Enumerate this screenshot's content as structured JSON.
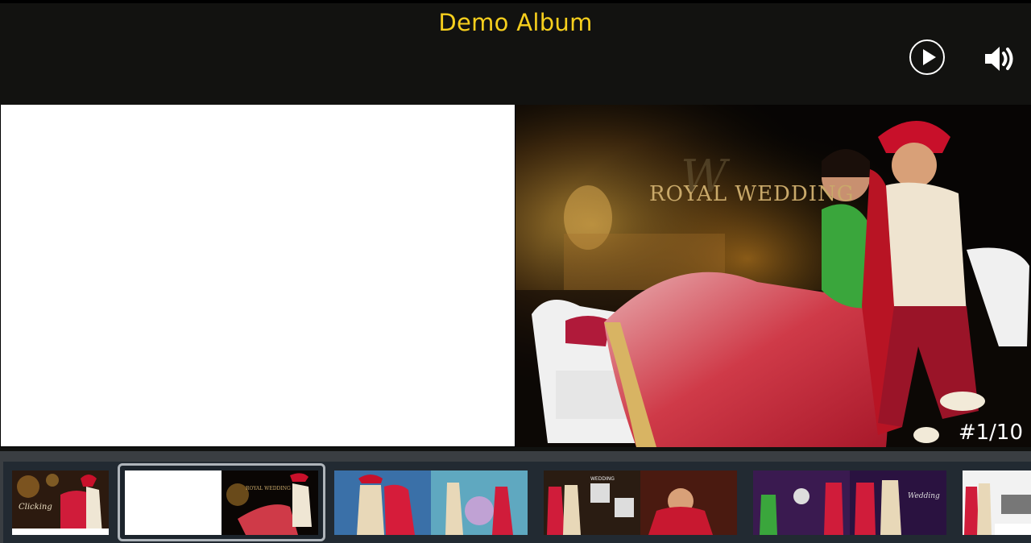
{
  "header": {
    "title": "Demo Album"
  },
  "controls": {
    "play_icon": "play-circle-icon",
    "volume_icon": "volume-icon"
  },
  "viewer": {
    "page_counter": "#1/10",
    "spread_text": "ROYAL WEDDING"
  },
  "thumbnails": [
    {
      "id": 1,
      "text": "Clicking"
    },
    {
      "id": 2,
      "text": "ROYAL WEDDING",
      "selected": true
    },
    {
      "id": 3,
      "text": ""
    },
    {
      "id": 4,
      "text": "WEDDING"
    },
    {
      "id": 5,
      "text": "Wedding"
    },
    {
      "id": 6,
      "text": ""
    }
  ],
  "colors": {
    "title": "#f7cf1d",
    "header_bg": "#121210",
    "strip_bg": "#222a32",
    "selection_border": "#aeb4ba"
  }
}
